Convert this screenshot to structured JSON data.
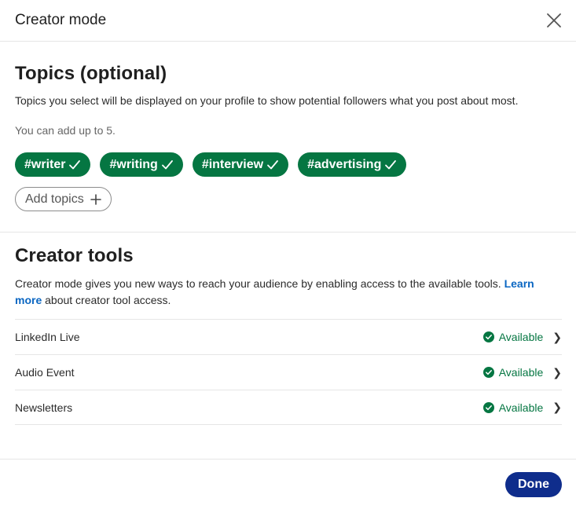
{
  "header": {
    "title": "Creator mode"
  },
  "topics": {
    "title": "Topics (optional)",
    "description": "Topics you select will be displayed on your profile to show potential followers what you post about most.",
    "limit_note": "You can add up to 5.",
    "chips": [
      {
        "label": "#writer"
      },
      {
        "label": "#writing"
      },
      {
        "label": "#interview"
      },
      {
        "label": "#advertising"
      }
    ],
    "add_label": "Add topics"
  },
  "tools": {
    "title": "Creator tools",
    "description_before": "Creator mode gives you new ways to reach your audience by enabling access to the available tools. ",
    "learn_more": "Learn more",
    "description_after": " about creator tool access.",
    "items": [
      {
        "name": "LinkedIn Live",
        "status": "Available"
      },
      {
        "name": "Audio Event",
        "status": "Available"
      },
      {
        "name": "Newsletters",
        "status": "Available"
      }
    ]
  },
  "footer": {
    "done_label": "Done"
  },
  "colors": {
    "accent_green": "#057642",
    "primary_blue": "#0f2d8c",
    "link_blue": "#0a66c2"
  }
}
